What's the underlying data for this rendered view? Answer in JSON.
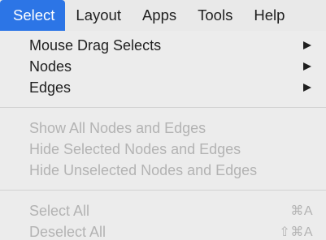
{
  "menubar": {
    "items": [
      {
        "label": "Select",
        "active": true
      },
      {
        "label": "Layout"
      },
      {
        "label": "Apps"
      },
      {
        "label": "Tools"
      },
      {
        "label": "Help"
      }
    ]
  },
  "dropdown": {
    "groups": [
      [
        {
          "label": "Mouse Drag Selects",
          "submenu": true,
          "enabled": true
        },
        {
          "label": "Nodes",
          "submenu": true,
          "enabled": true
        },
        {
          "label": "Edges",
          "submenu": true,
          "enabled": true
        }
      ],
      [
        {
          "label": "Show All Nodes and Edges",
          "enabled": false
        },
        {
          "label": "Hide Selected Nodes and Edges",
          "enabled": false
        },
        {
          "label": "Hide Unselected Nodes and Edges",
          "enabled": false
        }
      ],
      [
        {
          "label": "Select All",
          "shortcut": "⌘A",
          "enabled": false
        },
        {
          "label": "Deselect All",
          "shortcut": "⇧⌘A",
          "enabled": false
        }
      ]
    ]
  },
  "colors": {
    "active_menu_bg": "#2c75e6",
    "menu_bg": "#ececec",
    "text": "#1f1f1f",
    "disabled_text": "#b3b3b3"
  }
}
